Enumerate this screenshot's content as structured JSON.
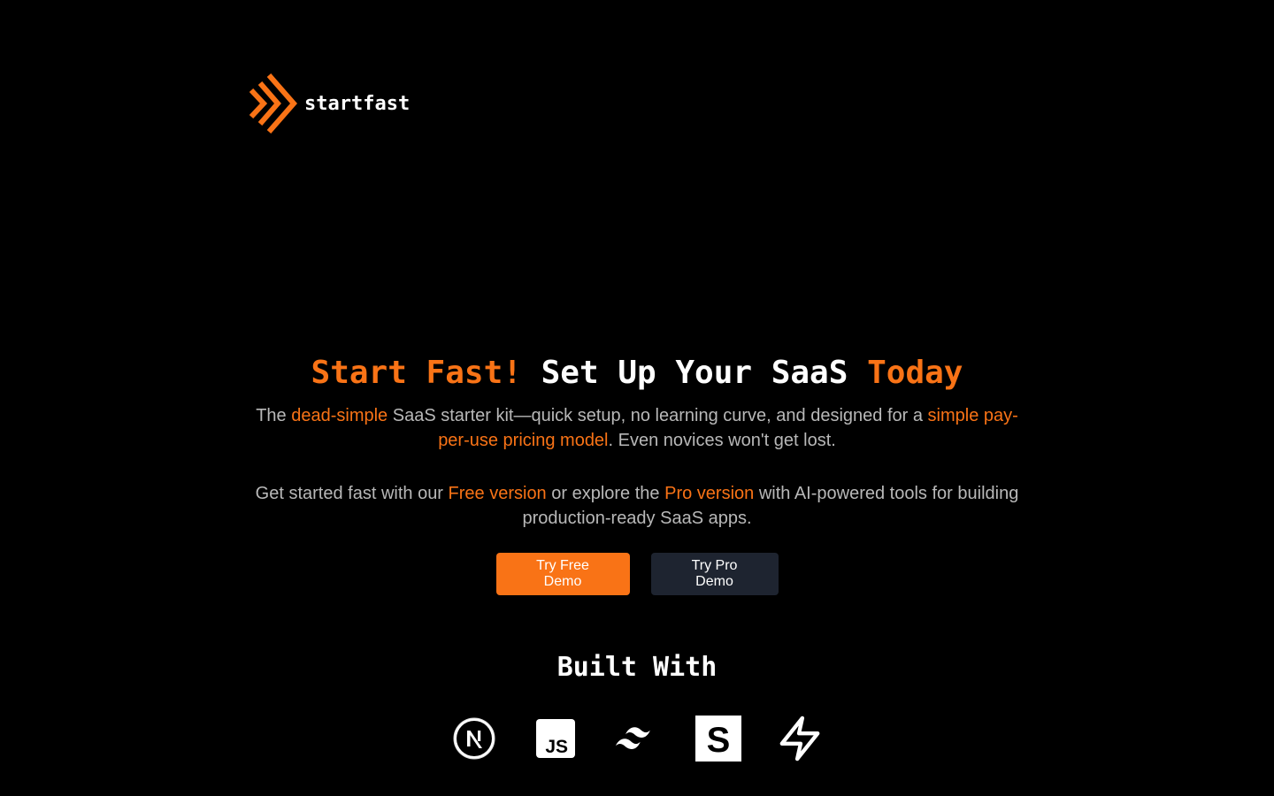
{
  "brand": {
    "name": "startfast",
    "accent_color": "#f97316"
  },
  "hero": {
    "title_part1": "Start Fast!",
    "title_part2": "Set Up Your SaaS",
    "title_part3": "Today",
    "para1": {
      "t1": "The ",
      "h1": "dead-simple",
      "t2": " SaaS starter kit—quick setup, no learning curve, and designed for a ",
      "h2": "simple pay-per-use pricing model",
      "t3": ". Even novices won't get lost."
    },
    "para2": {
      "t1": "Get started fast with our ",
      "h1": "Free version",
      "t2": " or explore the ",
      "h2": "Pro version",
      "t3": " with AI-powered tools for building production-ready SaaS apps."
    }
  },
  "buttons": {
    "free_demo": "Try Free Demo",
    "pro_demo": "Try Pro Demo"
  },
  "built_with": {
    "title": "Built With",
    "icons": [
      "nextjs-icon",
      "javascript-icon",
      "tailwind-icon",
      "shadcn-icon",
      "supabase-icon"
    ],
    "js_label": "JS"
  }
}
